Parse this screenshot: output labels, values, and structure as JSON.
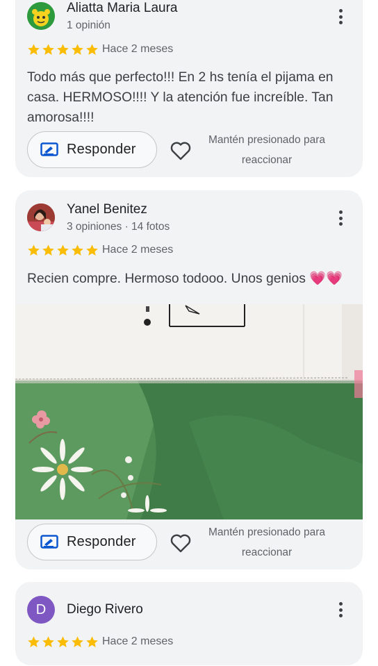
{
  "reviews": [
    {
      "author": "Aliatta Maria Laura",
      "meta": "1 opinión",
      "rating": 5,
      "when": "Hace 2 meses",
      "text": "Todo más que perfecto!!! En 2 hs tenía el pijama en casa. HERMOSO!!!! Y la atención fue increíble. Tan amorosa!!!!",
      "reply_label": "Responder",
      "hint": "Mantén presionado para reaccionar"
    },
    {
      "author": "Yanel Benitez",
      "meta": "3 opiniones · 14 fotos",
      "rating": 5,
      "when": "Hace 2 meses",
      "text": "Recien compre. Hermoso todooo. Unos genios 💗💗",
      "reply_label": "Responder",
      "hint": "Mantén presionado para reaccionar"
    },
    {
      "author": "Diego Rivero",
      "avatar_letter": "D",
      "rating": 5,
      "when": "Hace 2 meses"
    }
  ],
  "colors": {
    "star": "#fbbc04",
    "card_bg": "#f1f3f4",
    "reply_icon": "#0b57d0",
    "avatar_purple": "#7e57c2"
  }
}
